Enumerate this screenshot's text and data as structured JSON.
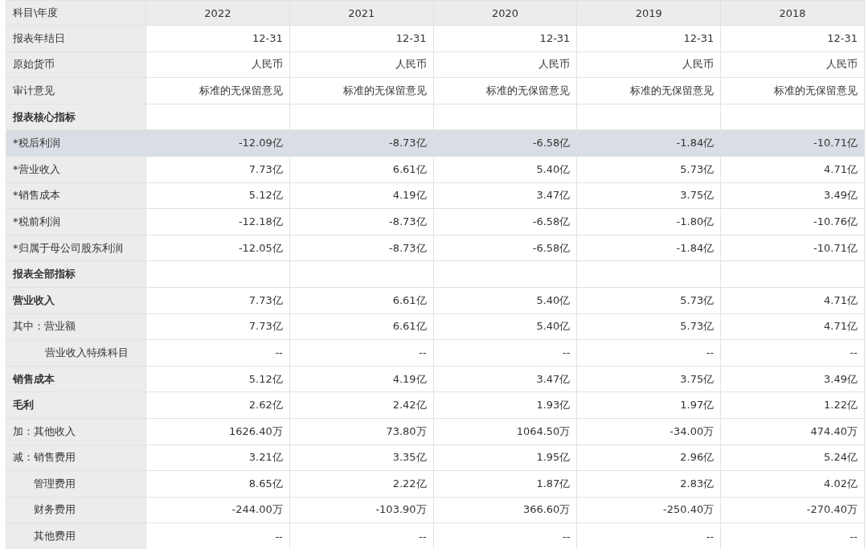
{
  "table": {
    "columns": [
      "科目\\年度",
      "2022",
      "2021",
      "2020",
      "2019",
      "2018"
    ],
    "rows": [
      {
        "label": "报表年结日",
        "kind": "plain",
        "selected": false,
        "values": [
          "12-31",
          "12-31",
          "12-31",
          "12-31",
          "12-31"
        ]
      },
      {
        "label": "原始货币",
        "kind": "plain",
        "selected": false,
        "values": [
          "人民币",
          "人民币",
          "人民币",
          "人民币",
          "人民币"
        ]
      },
      {
        "label": "审计意见",
        "kind": "plain",
        "selected": false,
        "values": [
          "标准的无保留意见",
          "标准的无保留意见",
          "标准的无保留意见",
          "标准的无保留意见",
          "标准的无保留意见"
        ]
      },
      {
        "label": "报表核心指标",
        "kind": "bold",
        "selected": false,
        "values": []
      },
      {
        "label": "*税后利润",
        "kind": "plain",
        "selected": true,
        "values": [
          "-12.09亿",
          "-8.73亿",
          "-6.58亿",
          "-1.84亿",
          "-10.71亿"
        ]
      },
      {
        "label": "*营业收入",
        "kind": "plain",
        "selected": false,
        "values": [
          "7.73亿",
          "6.61亿",
          "5.40亿",
          "5.73亿",
          "4.71亿"
        ]
      },
      {
        "label": "*销售成本",
        "kind": "plain",
        "selected": false,
        "values": [
          "5.12亿",
          "4.19亿",
          "3.47亿",
          "3.75亿",
          "3.49亿"
        ]
      },
      {
        "label": "*税前利润",
        "kind": "plain",
        "selected": false,
        "values": [
          "-12.18亿",
          "-8.73亿",
          "-6.58亿",
          "-1.80亿",
          "-10.76亿"
        ]
      },
      {
        "label": "*归属于母公司股东利润",
        "kind": "plain",
        "selected": false,
        "values": [
          "-12.05亿",
          "-8.73亿",
          "-6.58亿",
          "-1.84亿",
          "-10.71亿"
        ]
      },
      {
        "label": "报表全部指标",
        "kind": "bold",
        "selected": false,
        "values": []
      },
      {
        "label": "营业收入",
        "kind": "bold",
        "selected": false,
        "values": [
          "7.73亿",
          "6.61亿",
          "5.40亿",
          "5.73亿",
          "4.71亿"
        ]
      },
      {
        "label": "其中：营业额",
        "kind": "plain",
        "selected": false,
        "values": [
          "7.73亿",
          "6.61亿",
          "5.40亿",
          "5.73亿",
          "4.71亿"
        ]
      },
      {
        "label": "营业收入特殊科目",
        "kind": "subsub",
        "selected": false,
        "values": [
          "--",
          "--",
          "--",
          "--",
          "--"
        ]
      },
      {
        "label": "销售成本",
        "kind": "bold",
        "selected": false,
        "values": [
          "5.12亿",
          "4.19亿",
          "3.47亿",
          "3.75亿",
          "3.49亿"
        ]
      },
      {
        "label": "毛利",
        "kind": "bold",
        "selected": false,
        "values": [
          "2.62亿",
          "2.42亿",
          "1.93亿",
          "1.97亿",
          "1.22亿"
        ]
      },
      {
        "label": "加：其他收入",
        "kind": "plain",
        "selected": false,
        "values": [
          "1626.40万",
          "73.80万",
          "1064.50万",
          "-34.00万",
          "474.40万"
        ]
      },
      {
        "label": "减：销售费用",
        "kind": "plain",
        "selected": false,
        "values": [
          "3.21亿",
          "3.35亿",
          "1.95亿",
          "2.96亿",
          "5.24亿"
        ]
      },
      {
        "label": "管理费用",
        "kind": "sub",
        "selected": false,
        "values": [
          "8.65亿",
          "2.22亿",
          "1.87亿",
          "2.83亿",
          "4.02亿"
        ]
      },
      {
        "label": "财务费用",
        "kind": "sub",
        "selected": false,
        "values": [
          "-244.00万",
          "-103.90万",
          "366.60万",
          "-250.40万",
          "-270.40万"
        ]
      },
      {
        "label": "其他费用",
        "kind": "sub",
        "selected": false,
        "values": [
          "--",
          "--",
          "--",
          "--",
          "--"
        ]
      }
    ]
  }
}
